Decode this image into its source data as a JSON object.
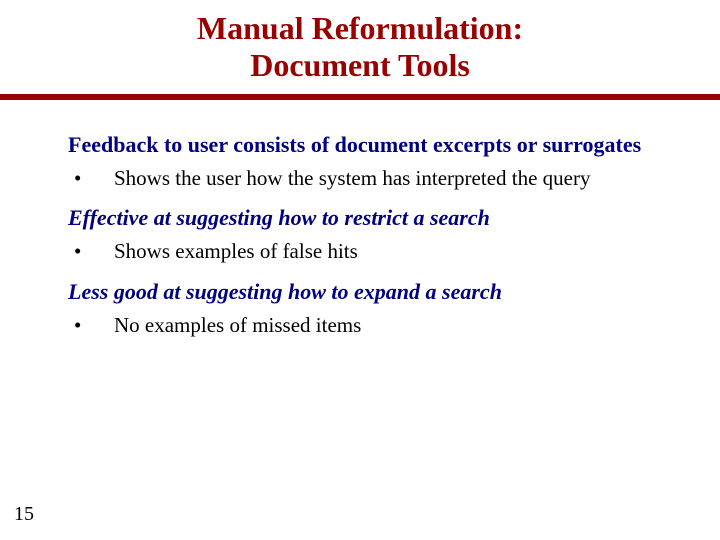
{
  "colors": {
    "title": "#990000",
    "rule": "#990000",
    "heading_navy": "#000080",
    "body_text": "#000000"
  },
  "title": {
    "line1": "Manual Reformulation:",
    "line2": "Document Tools"
  },
  "sections": [
    {
      "heading": "Feedback to user consists of document excerpts or surrogates",
      "italic": false,
      "navy": true,
      "bullets": [
        "Shows the user how the system has interpreted the query"
      ]
    },
    {
      "heading": "Effective at suggesting how to restrict a search",
      "italic": true,
      "navy": true,
      "bullets": [
        "Shows examples of false hits"
      ]
    },
    {
      "heading": "Less good at suggesting how to expand a search",
      "italic": true,
      "navy": true,
      "bullets": [
        "No examples of missed items"
      ]
    }
  ],
  "page_number": "15"
}
